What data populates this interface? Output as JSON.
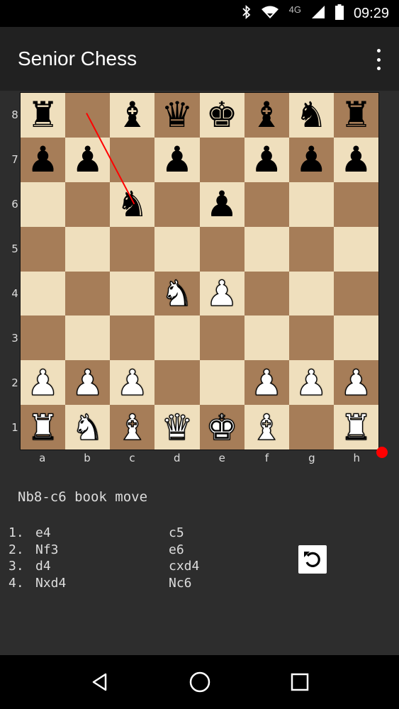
{
  "status_bar": {
    "time": "09:29",
    "network": "4G",
    "icons": [
      "bluetooth-icon",
      "wifi-icon",
      "cell-signal-icon",
      "battery-icon"
    ]
  },
  "app": {
    "title": "Senior Chess",
    "menu_icon": "overflow-menu-icon"
  },
  "board": {
    "orientation": "white-bottom",
    "ranks": [
      "8",
      "7",
      "6",
      "5",
      "4",
      "3",
      "2",
      "1"
    ],
    "files": [
      "a",
      "b",
      "c",
      "d",
      "e",
      "f",
      "g",
      "h"
    ],
    "position": [
      [
        "r",
        "",
        "b",
        "q",
        "k",
        "b",
        "n",
        "r"
      ],
      [
        "p",
        "p",
        "",
        "p",
        "",
        "p",
        "p",
        "p"
      ],
      [
        "",
        "",
        "n",
        "",
        "p",
        "",
        "",
        ""
      ],
      [
        "",
        "",
        "",
        "",
        "",
        "",
        "",
        ""
      ],
      [
        "",
        "",
        "",
        "N",
        "P",
        "",
        "",
        ""
      ],
      [
        "",
        "",
        "",
        "",
        "",
        "",
        "",
        ""
      ],
      [
        "P",
        "P",
        "P",
        "",
        "",
        "P",
        "P",
        "P"
      ],
      [
        "R",
        "N",
        "B",
        "Q",
        "K",
        "B",
        "",
        "R"
      ]
    ],
    "last_move": {
      "from": "b8",
      "to": "c6"
    },
    "arrow_color": "#ff0000",
    "turn_indicator_color": "#ff0000",
    "light_square_color": "#efdfbd",
    "dark_square_color": "#a67d58"
  },
  "status_text": "Nb8-c6 book move",
  "moves": [
    {
      "num": "1.",
      "white": "e4",
      "black": "c5"
    },
    {
      "num": "2.",
      "white": "Nf3",
      "black": "e6"
    },
    {
      "num": "3.",
      "white": "d4",
      "black": "cxd4"
    },
    {
      "num": "4.",
      "white": "Nxd4",
      "black": "Nc6"
    }
  ],
  "undo_icon": "undo-icon",
  "nav_bar": {
    "buttons": [
      "back-icon",
      "home-icon",
      "recents-icon"
    ]
  }
}
